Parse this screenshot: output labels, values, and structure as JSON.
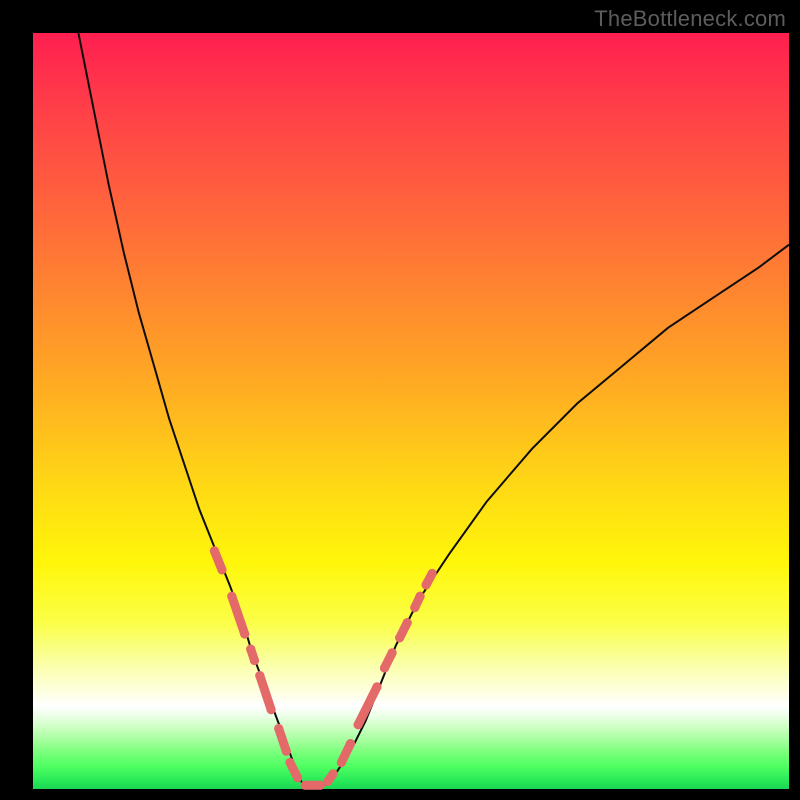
{
  "watermark": "TheBottleneck.com",
  "colors": {
    "page_bg": "#000000",
    "curve": "#0d0d0d",
    "beads": "#e46a6a",
    "gradient_top": "#ff1f50",
    "gradient_mid": "#ffd915",
    "gradient_glow": "#ffffff",
    "gradient_bottom": "#1dd452"
  },
  "chart_data": {
    "type": "line",
    "title": "",
    "xlabel": "",
    "ylabel": "",
    "xlim": [
      0,
      100
    ],
    "ylim": [
      0,
      100
    ],
    "grid": false,
    "legend": false,
    "series": [
      {
        "name": "left-branch",
        "x": [
          6,
          8,
          10,
          12,
          14,
          16,
          18,
          20,
          22,
          24,
          26,
          27.5,
          29,
          30.5,
          32,
          33.5,
          35,
          36
        ],
        "y": [
          100,
          90,
          80,
          71,
          63,
          56,
          49,
          43,
          37,
          32,
          27,
          23,
          18,
          14,
          10,
          6,
          2,
          0
        ]
      },
      {
        "name": "right-branch",
        "x": [
          38,
          40,
          42,
          44,
          46,
          48,
          51,
          55,
          60,
          66,
          72,
          78,
          84,
          90,
          96,
          100
        ],
        "y": [
          0,
          2,
          5,
          9,
          14,
          19,
          25,
          31,
          38,
          45,
          51,
          56,
          61,
          65,
          69,
          72
        ]
      },
      {
        "name": "beads",
        "comment": "pink segments/dots along the curve near the valley (approximate visual markers)",
        "segments": [
          {
            "x1": 24.0,
            "y1": 31.5,
            "x2": 25.0,
            "y2": 29.0
          },
          {
            "x1": 26.3,
            "y1": 25.5,
            "x2": 28.0,
            "y2": 20.5
          },
          {
            "x1": 28.8,
            "y1": 18.5,
            "x2": 29.3,
            "y2": 17.0
          },
          {
            "x1": 30.0,
            "y1": 15.0,
            "x2": 31.5,
            "y2": 10.5
          },
          {
            "x1": 32.5,
            "y1": 8.0,
            "x2": 33.5,
            "y2": 5.0
          },
          {
            "x1": 34.0,
            "y1": 3.5,
            "x2": 35.0,
            "y2": 1.5
          },
          {
            "x1": 36.0,
            "y1": 0.5,
            "x2": 38.0,
            "y2": 0.5
          },
          {
            "x1": 39.0,
            "y1": 1.0,
            "x2": 39.7,
            "y2": 2.0
          },
          {
            "x1": 40.8,
            "y1": 3.5,
            "x2": 42.0,
            "y2": 6.0
          },
          {
            "x1": 43.0,
            "y1": 8.5,
            "x2": 45.5,
            "y2": 13.5
          },
          {
            "x1": 46.5,
            "y1": 16.0,
            "x2": 47.5,
            "y2": 18.0
          },
          {
            "x1": 48.5,
            "y1": 20.0,
            "x2": 49.5,
            "y2": 22.0
          },
          {
            "x1": 50.5,
            "y1": 24.0,
            "x2": 51.2,
            "y2": 25.5
          },
          {
            "x1": 52.0,
            "y1": 27.0,
            "x2": 52.8,
            "y2": 28.5
          }
        ]
      }
    ]
  }
}
